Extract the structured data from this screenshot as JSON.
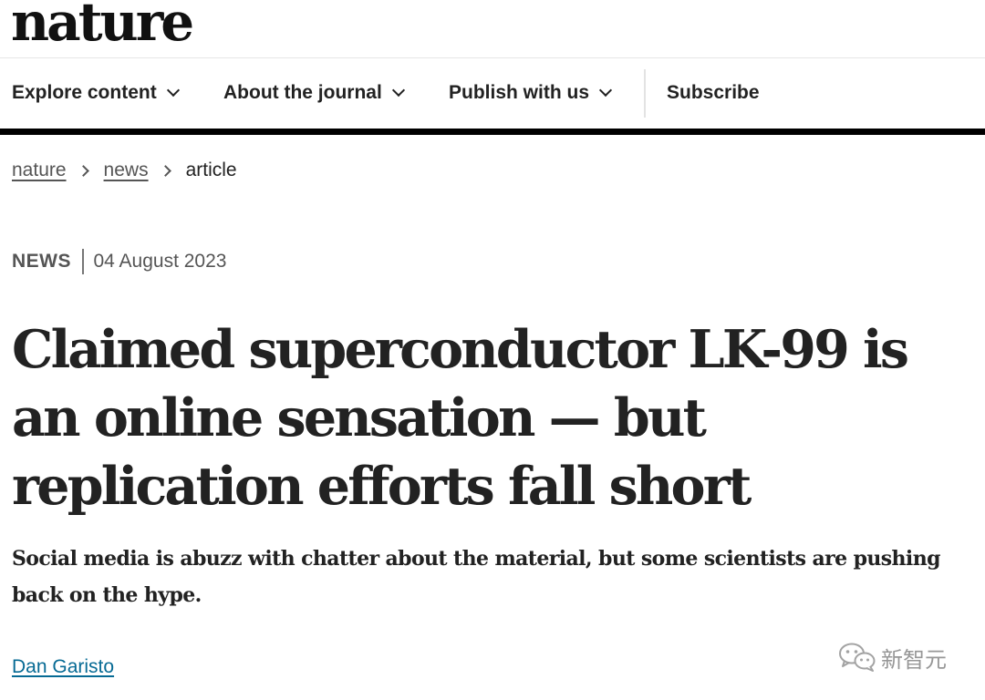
{
  "header": {
    "logo": "nature"
  },
  "nav": {
    "items": [
      {
        "label": "Explore content",
        "has_dropdown": true
      },
      {
        "label": "About the journal",
        "has_dropdown": true
      },
      {
        "label": "Publish with us",
        "has_dropdown": true
      }
    ],
    "subscribe_label": "Subscribe"
  },
  "breadcrumb": {
    "items": [
      "nature",
      "news"
    ],
    "current": "article"
  },
  "meta": {
    "type": "NEWS",
    "date": "04 August 2023"
  },
  "article": {
    "title": "Claimed superconductor LK-99 is an online sensation — but replication efforts fall short",
    "standfirst": "Social media is abuzz with chatter about the material, but some scientists are pushing back on the hype.",
    "author": "Dan Garisto"
  },
  "watermark": {
    "text": "新智元",
    "icon": "wechat-icon"
  },
  "colors": {
    "author_link": "#066a94",
    "rule": "#000000"
  }
}
